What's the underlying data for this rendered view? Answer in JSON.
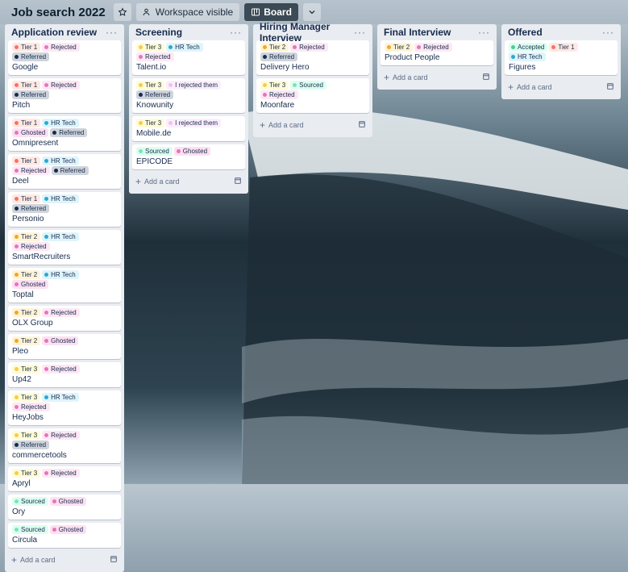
{
  "board": {
    "title": "Job search 2022",
    "visibility_label": "Workspace visible",
    "view_label": "Board"
  },
  "label_styles": {
    "Tier 1": {
      "bg": "#ffe9e2",
      "dot": "#f87168"
    },
    "Tier 2": {
      "bg": "#fff4d6",
      "dot": "#f5a623"
    },
    "Tier 3": {
      "bg": "#fffbd6",
      "dot": "#f5cd47"
    },
    "Rejected": {
      "bg": "#fde8f4",
      "dot": "#e774bb"
    },
    "Referred": {
      "bg": "#cfd4db",
      "dot": "#172b4d"
    },
    "HR Tech": {
      "bg": "#dff4fb",
      "dot": "#29a9d1"
    },
    "Ghosted": {
      "bg": "#fde0f1",
      "dot": "#e774bb"
    },
    "Sourced": {
      "bg": "#dcfff1",
      "dot": "#7ee2b8"
    },
    "I rejected them": {
      "bg": "#fbeefb",
      "dot": "#f0c2f0"
    },
    "Accepted": {
      "bg": "#dcfff1",
      "dot": "#4bce97"
    }
  },
  "lists": [
    {
      "title": "Application review",
      "add_label": "Add a card",
      "cards": [
        {
          "title": "Google",
          "labels": [
            "Tier 1",
            "Rejected",
            "Referred"
          ]
        },
        {
          "title": "Pitch",
          "labels": [
            "Tier 1",
            "Rejected",
            "Referred"
          ]
        },
        {
          "title": "Omnipresent",
          "labels": [
            "Tier 1",
            "HR Tech",
            "Ghosted",
            "Referred"
          ]
        },
        {
          "title": "Deel",
          "labels": [
            "Tier 1",
            "HR Tech",
            "Rejected",
            "Referred"
          ]
        },
        {
          "title": "Personio",
          "labels": [
            "Tier 1",
            "HR Tech",
            "Referred"
          ]
        },
        {
          "title": "SmartRecruiters",
          "labels": [
            "Tier 2",
            "HR Tech",
            "Rejected"
          ]
        },
        {
          "title": "Toptal",
          "labels": [
            "Tier 2",
            "HR Tech",
            "Ghosted"
          ]
        },
        {
          "title": "OLX Group",
          "labels": [
            "Tier 2",
            "Rejected"
          ]
        },
        {
          "title": "Pleo",
          "labels": [
            "Tier 2",
            "Ghosted"
          ]
        },
        {
          "title": "Up42",
          "labels": [
            "Tier 3",
            "Rejected"
          ]
        },
        {
          "title": "HeyJobs",
          "labels": [
            "Tier 3",
            "HR Tech",
            "Rejected"
          ]
        },
        {
          "title": "commercetools",
          "labels": [
            "Tier 3",
            "Rejected",
            "Referred"
          ]
        },
        {
          "title": "Apryl",
          "labels": [
            "Tier 3",
            "Rejected"
          ]
        },
        {
          "title": "Ory",
          "labels": [
            "Sourced",
            "Ghosted"
          ]
        },
        {
          "title": "Circula",
          "labels": [
            "Sourced",
            "Ghosted"
          ]
        }
      ]
    },
    {
      "title": "Screening",
      "add_label": "Add a card",
      "cards": [
        {
          "title": "Talent.io",
          "labels": [
            "Tier 3",
            "HR Tech",
            "Rejected"
          ]
        },
        {
          "title": "Knowunity",
          "labels": [
            "Tier 3",
            "I rejected them",
            "Referred"
          ]
        },
        {
          "title": "Mobile.de",
          "labels": [
            "Tier 3",
            "I rejected them"
          ]
        },
        {
          "title": "EPICODE",
          "labels": [
            "Sourced",
            "Ghosted"
          ]
        }
      ]
    },
    {
      "title": "Hiring Manager Interview",
      "add_label": "Add a card",
      "cards": [
        {
          "title": "Delivery Hero",
          "labels": [
            "Tier 2",
            "Rejected",
            "Referred"
          ]
        },
        {
          "title": "Moonfare",
          "labels": [
            "Tier 3",
            "Sourced",
            "Rejected"
          ]
        }
      ]
    },
    {
      "title": "Final Interview",
      "add_label": "Add a card",
      "cards": [
        {
          "title": "Product People",
          "labels": [
            "Tier 2",
            "Rejected"
          ]
        }
      ]
    },
    {
      "title": "Offered",
      "add_label": "Add a card",
      "cards": [
        {
          "title": "Figures",
          "labels": [
            "Accepted",
            "Tier 1",
            "HR Tech"
          ]
        }
      ]
    }
  ]
}
